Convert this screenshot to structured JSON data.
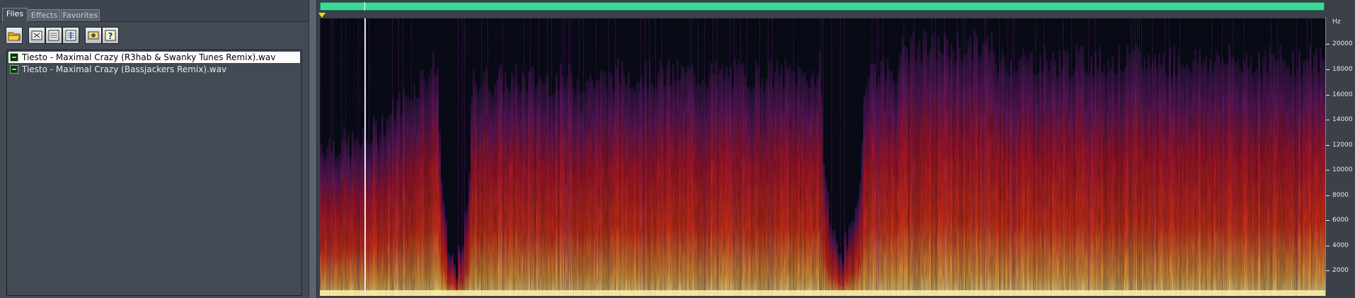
{
  "organizer": {
    "tabs": [
      {
        "label": "Files",
        "active": true
      },
      {
        "label": "Effects",
        "active": false
      },
      {
        "label": "Favorites",
        "active": false
      }
    ],
    "toolbar": [
      {
        "name": "open-file-icon"
      },
      {
        "name": "close-file-icon"
      },
      {
        "name": "insert-file-icon"
      },
      {
        "name": "insert-multitrack-icon"
      },
      {
        "name": "options-icon"
      },
      {
        "name": "help-icon"
      }
    ],
    "files": [
      {
        "name": "Tiesto - Maximal Crazy (R3hab & Swanky Tunes Remix).wav",
        "selected": true
      },
      {
        "name": "Tiesto - Maximal Crazy (Bassjackers Remix).wav",
        "selected": false
      }
    ]
  },
  "editor": {
    "view": "spectral",
    "overview_color": "#3ed89a",
    "freq_axis": {
      "unit": "Hz",
      "ticks": [
        "20000",
        "18000",
        "16000",
        "14000",
        "12000",
        "10000",
        "8000",
        "6000",
        "4000",
        "2000"
      ],
      "max": 22050
    },
    "colors": {
      "background": "#0b0d1c",
      "low": "#3a1c55",
      "mid": "#cf1e1a",
      "high": "#fff1a6"
    }
  }
}
